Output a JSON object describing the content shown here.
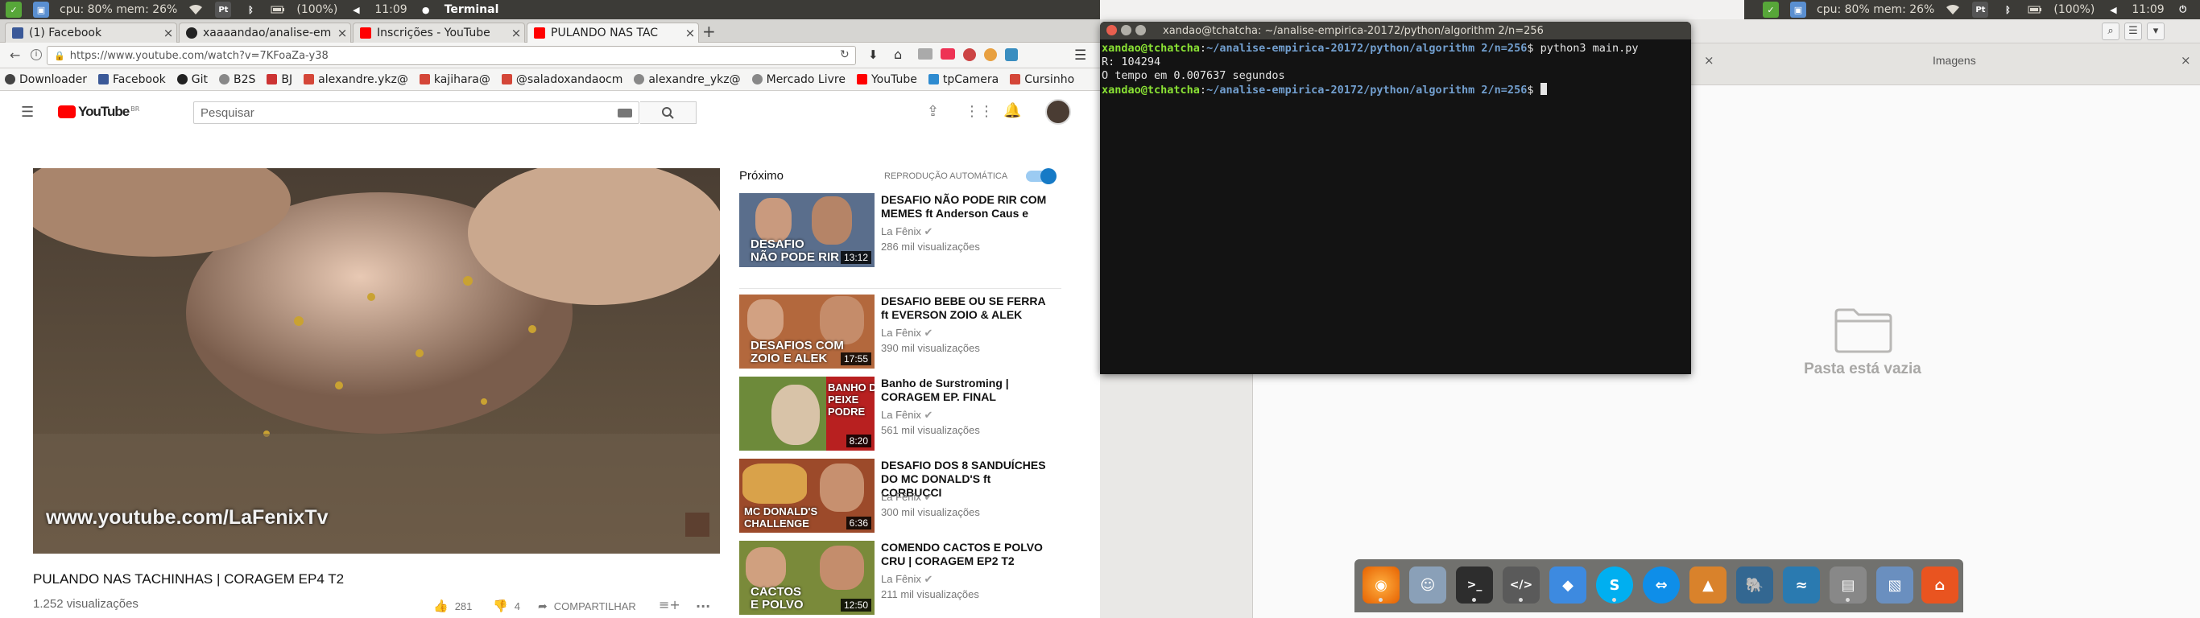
{
  "panel_left": {
    "cpu_mem": "cpu: 80% mem: 26%",
    "battery": "(100%)",
    "clock": "11:09",
    "app": "Terminal"
  },
  "panel_right": {
    "cpu_mem": "cpu: 80% mem: 26%",
    "battery": "(100%)",
    "clock": "11:09"
  },
  "browser": {
    "tabs": [
      {
        "label": "(1) Facebook",
        "icon": "facebook-icon",
        "color": "#3b5998"
      },
      {
        "label": "xaaaandao/analise-em",
        "icon": "github-icon",
        "color": "#222222"
      },
      {
        "label": "Inscrições - YouTube",
        "icon": "youtube-icon",
        "color": "#ff0000"
      },
      {
        "label": "PULANDO NAS TAC",
        "icon": "youtube-icon",
        "color": "#ff0000"
      }
    ],
    "new_tab": "+",
    "url": "https://www.youtube.com/watch?v=7KFoaZa-y38",
    "bookmarks": [
      {
        "label": "Downloader",
        "icon": "download-icon"
      },
      {
        "label": "Facebook",
        "icon": "facebook-icon"
      },
      {
        "label": "Git",
        "icon": "github-icon"
      },
      {
        "label": "B2S",
        "icon": "globe-icon"
      },
      {
        "label": "BJ",
        "icon": "bj-icon"
      },
      {
        "label": "alexandre.ykz@",
        "icon": "gmail-icon"
      },
      {
        "label": "kajihara@",
        "icon": "gmail-icon"
      },
      {
        "label": "@saladoxandaocm",
        "icon": "gmail-icon"
      },
      {
        "label": "alexandre_ykz@",
        "icon": "globe-icon"
      },
      {
        "label": "Mercado Livre",
        "icon": "globe-icon"
      },
      {
        "label": "YouTube",
        "icon": "youtube-icon"
      },
      {
        "label": "tpCamera",
        "icon": "camera-icon"
      },
      {
        "label": "Cursinho",
        "icon": "gmail-icon"
      }
    ]
  },
  "youtube": {
    "logo": "YouTube",
    "logo_region": "BR",
    "search_placeholder": "Pesquisar",
    "watermark": "www.youtube.com/LaFenixTv",
    "video_title": "PULANDO NAS TACHINHAS | CORAGEM EP4 T2",
    "views": "1.252 visualizações",
    "likes": "281",
    "dislikes": "4",
    "share": "COMPARTILHAR",
    "more": "...",
    "up_next": "Próximo",
    "autoplay_label": "REPRODUÇÃO AUTOMÁTICA",
    "autoplay_on": true,
    "recommendations": [
      {
        "title": "DESAFIO NÃO PODE RIR COM MEMES ft Anderson Caus e",
        "channel": "La Fênix",
        "views": "286 mil visualizações",
        "duration": "13:12",
        "thumb_text": "DESAFIO\nNÃO PODE RIR",
        "thumb_color": "#5a6e8c"
      },
      {
        "title": "DESAFIO BEBE OU SE FERRA ft EVERSON ZOIO & ALEK",
        "channel": "La Fênix",
        "views": "390 mil visualizações",
        "duration": "17:55",
        "thumb_text": "DESAFIOS COM\nZOIO E ALEK",
        "thumb_color": "#b3683d"
      },
      {
        "title": "Banho de Surstroming | CORAGEM EP. FINAL",
        "channel": "La Fênix",
        "views": "561 mil visualizações",
        "duration": "8:20",
        "thumb_text": "BANHO DE\nPEIXE\nPODRE",
        "thumb_color": "#6d8a3a"
      },
      {
        "title": "DESAFIO DOS 8 SANDUÍCHES DO MC DONALD'S ft CORBUCCI",
        "channel": "La Fênix",
        "views": "300 mil visualizações",
        "duration": "6:36",
        "thumb_text": "MC DONALD'S\nCHALLENGE",
        "thumb_color": "#9c4a2a"
      },
      {
        "title": "COMENDO CACTOS E POLVO CRU | CORAGEM EP2 T2",
        "channel": "La Fênix",
        "views": "211 mil visualizações",
        "duration": "12:50",
        "thumb_text": "CACTOS\nE POLVO",
        "thumb_color": "#7a8a3a"
      }
    ]
  },
  "filemanager": {
    "tab_title": "Imagens",
    "empty_text": "Pasta está vazia"
  },
  "terminal": {
    "title": "xandao@tchatcha: ~/analise-empirica-20172/python/algorithm 2/n=256",
    "prompt_user": "xandao@tchatcha",
    "prompt_path": "~/analise-empirica-20172/python/algorithm 2/n=256",
    "command": "python3 main.py",
    "output_1": "R: 104294",
    "output_2": "O tempo em 0.007637 segundos"
  },
  "dock": [
    {
      "name": "firefox-icon",
      "color": "#e66000",
      "active": true
    },
    {
      "name": "files-icon",
      "color": "#8aa0b8",
      "active": false
    },
    {
      "name": "terminal-icon",
      "color": "#2d2d2d",
      "active": true
    },
    {
      "name": "editor-icon",
      "color": "#5a5a5a",
      "active": true
    },
    {
      "name": "dropbox-icon",
      "color": "#3d8ae0",
      "active": false
    },
    {
      "name": "skype-icon",
      "color": "#00aff0",
      "active": true
    },
    {
      "name": "teamviewer-icon",
      "color": "#0e8ee9",
      "active": false
    },
    {
      "name": "matlab-icon",
      "color": "#d9822b",
      "active": false
    },
    {
      "name": "postgres-icon",
      "color": "#336791",
      "active": false
    },
    {
      "name": "mysql-workbench-icon",
      "color": "#2a7ab0",
      "active": false
    },
    {
      "name": "network-icon",
      "color": "#888888",
      "active": true
    },
    {
      "name": "virtualbox-icon",
      "color": "#6a8fbf",
      "active": false
    },
    {
      "name": "ubuntu-software-icon",
      "color": "#e95420",
      "active": false
    }
  ]
}
